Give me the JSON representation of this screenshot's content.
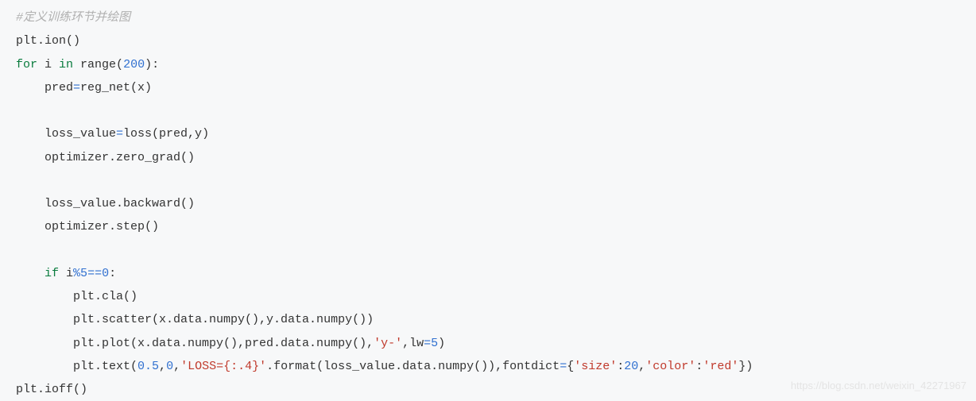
{
  "code": {
    "comment": "#定义训练环节并绘图",
    "line1_a": "plt.ion()",
    "line2_for": "for",
    "line2_i": " i ",
    "line2_in": "in",
    "line2_range": " range(",
    "line2_num": "200",
    "line2_end": "):",
    "line3_a": "    pred",
    "line3_eq": "=",
    "line3_b": "reg_net(x)",
    "line5_a": "    loss_value",
    "line5_eq": "=",
    "line5_b": "loss(pred,y)",
    "line6": "    optimizer.zero_grad()",
    "line8": "    loss_value.backward()",
    "line9": "    optimizer.step()",
    "line11_if": "    if",
    "line11_a": " i",
    "line11_mod": "%",
    "line11_num5": "5",
    "line11_eqeq": "==",
    "line11_num0": "0",
    "line11_colon": ":",
    "line12": "        plt.cla()",
    "line13": "        plt.scatter(x.data.numpy(),y.data.numpy())",
    "line14_a": "        plt.plot(x.data.numpy(),pred.data.numpy(),",
    "line14_str": "'y-'",
    "line14_b": ",lw",
    "line14_eq": "=",
    "line14_num": "5",
    "line14_c": ")",
    "line15_a": "        plt.text(",
    "line15_num1": "0.5",
    "line15_c1": ",",
    "line15_num2": "0",
    "line15_c2": ",",
    "line15_str1": "'LOSS={:.4}'",
    "line15_b": ".format(loss_value.data.numpy()),fontdict",
    "line15_eq": "=",
    "line15_brace1": "{",
    "line15_str2": "'size'",
    "line15_colon1": ":",
    "line15_num3": "20",
    "line15_c3": ",",
    "line15_str3": "'color'",
    "line15_colon2": ":",
    "line15_str4": "'red'",
    "line15_brace2": "})",
    "line16": "plt.ioff()"
  },
  "watermark": "https://blog.csdn.net/weixin_42271967"
}
